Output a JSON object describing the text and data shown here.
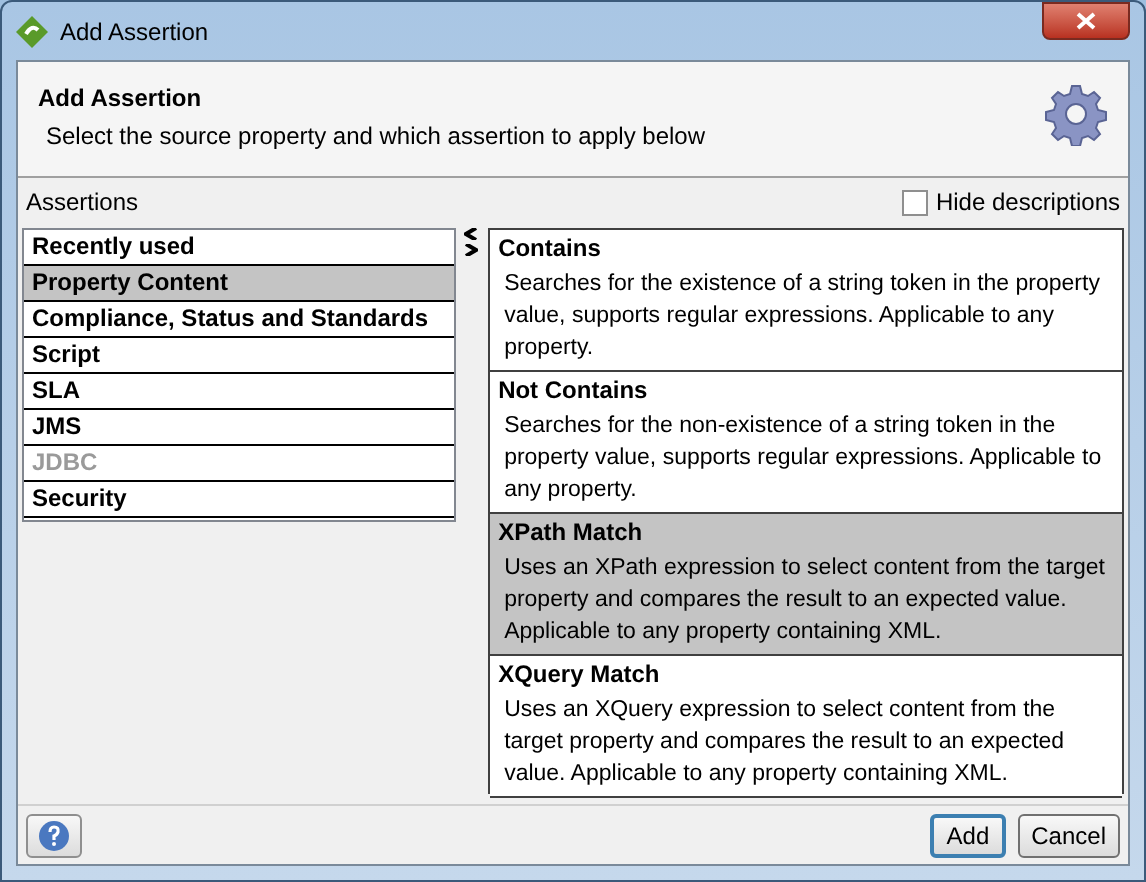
{
  "window": {
    "title": "Add Assertion"
  },
  "header": {
    "title": "Add Assertion",
    "subtitle": "Select the source property and which assertion to apply below"
  },
  "assertions_label": "Assertions",
  "hide_descriptions": {
    "label": "Hide descriptions",
    "checked": false
  },
  "categories": [
    {
      "label": "Recently used",
      "selected": false,
      "disabled": false
    },
    {
      "label": "Property Content",
      "selected": true,
      "disabled": false
    },
    {
      "label": "Compliance, Status and Standards",
      "selected": false,
      "disabled": false
    },
    {
      "label": "Script",
      "selected": false,
      "disabled": false
    },
    {
      "label": "SLA",
      "selected": false,
      "disabled": false
    },
    {
      "label": "JMS",
      "selected": false,
      "disabled": false
    },
    {
      "label": "JDBC",
      "selected": false,
      "disabled": true
    },
    {
      "label": "Security",
      "selected": false,
      "disabled": false
    }
  ],
  "assertions": [
    {
      "name": "Contains",
      "description": "Searches for the existence of a string token in the property value, supports regular expressions. Applicable to any property.",
      "selected": false
    },
    {
      "name": "Not Contains",
      "description": "Searches for the non-existence of a string token in the property value, supports regular expressions. Applicable to any property.",
      "selected": false
    },
    {
      "name": "XPath Match",
      "description": "Uses an XPath expression to select content from the target property and compares the result to an expected value. Applicable to any property containing XML.",
      "selected": true
    },
    {
      "name": "XQuery Match",
      "description": "Uses an XQuery expression to select content from the target property and compares the result to an expected value. Applicable to any property containing XML.",
      "selected": false
    }
  ],
  "buttons": [
    {
      "label": "Add",
      "default": true
    },
    {
      "label": "Cancel",
      "default": false
    }
  ]
}
